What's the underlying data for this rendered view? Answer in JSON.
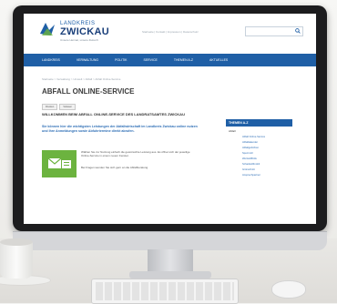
{
  "header": {
    "logo_top": "LANDKREIS",
    "logo_main": "ZWICKAU",
    "logo_tagline": "Unsere Heimat, unsere Zukunft",
    "top_links": "Startseite | Kontakt | Impressum | Datenschutz",
    "search_placeholder": ""
  },
  "nav": {
    "items": [
      "LANDKREIS",
      "VERWALTUNG",
      "POLITIK",
      "SERVICE",
      "THEMEN A-Z",
      "AKTUELLES"
    ]
  },
  "main": {
    "breadcrumb": "Startseite > Verwaltung > Umwelt > Abfall > Abfall Online-Service",
    "title": "ABFALL ONLINE-SERVICE",
    "toolbar": [
      "Drucken",
      "Vorlesen"
    ],
    "welcome": "WILLKOMMEN BEIM ABFALL ONLINE-SERVICE DES LANDRATSAMTES ZWICKAU",
    "intro": "Sie können hier die wichtigsten Leistungen der Abfallwirtschaft im Landkreis Zwickau online nutzen und Ihre Anmeldungen sowie Abfuhrtermine direkt abrufen.",
    "app_text": "Wählen Sie zur Nutzung einfach die gewünschte Leistung aus. Es öffnet sich der jeweilige Online-Service in einem neuen Fenster.",
    "app_text2": "Bei Fragen wenden Sie sich gern an die Abfallberatung."
  },
  "sidebar": {
    "heading": "THEMEN A-Z",
    "sub": "Abfall",
    "links": [
      "Abfall Online-Service",
      "Abfallkalender",
      "Abfallgebühren",
      "Sperrmüll",
      "Wertstoffhöfe",
      "Schadstoffmobil",
      "Grünschnitt",
      "Ansprechpartner"
    ]
  },
  "colors": {
    "brand_blue": "#1f5fa6",
    "accent_green": "#6cb33f"
  }
}
